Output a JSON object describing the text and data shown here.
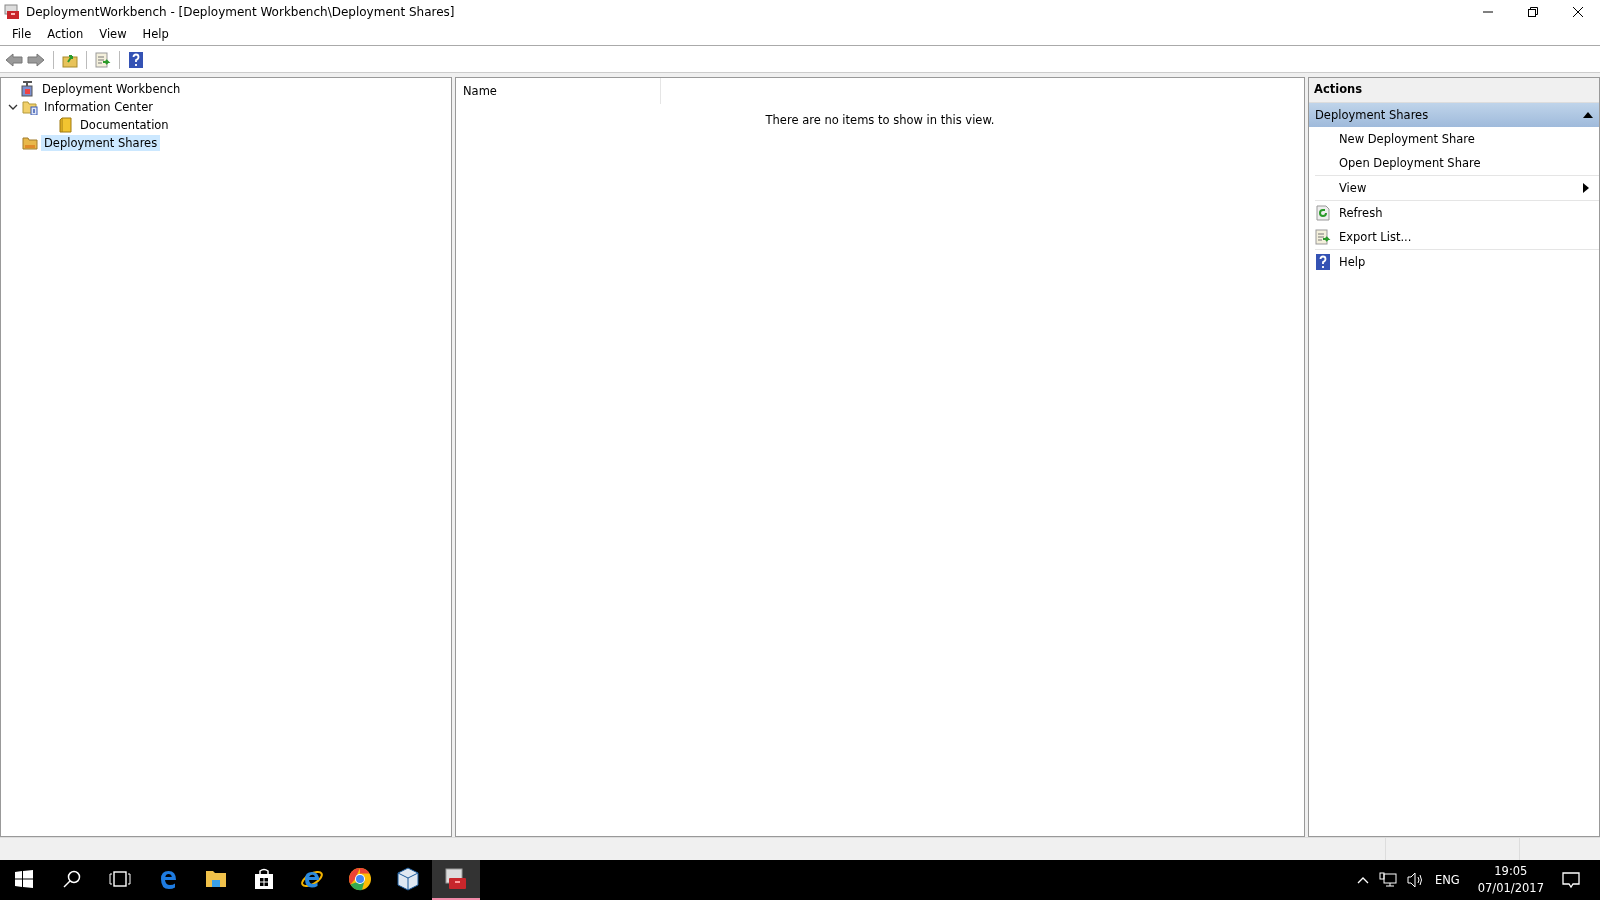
{
  "window": {
    "title": "DeploymentWorkbench - [Deployment Workbench\\Deployment Shares]"
  },
  "menu": [
    "File",
    "Action",
    "View",
    "Help"
  ],
  "tree": [
    {
      "label": "Deployment Workbench",
      "selected": false,
      "children": [
        {
          "label": "Information Center",
          "selected": false,
          "expanded": true,
          "children": [
            {
              "label": "Documentation",
              "selected": false
            }
          ]
        },
        {
          "label": "Deployment Shares",
          "selected": true
        }
      ]
    }
  ],
  "list": {
    "columns": [
      "Name"
    ],
    "empty_message": "There are no items to show in this view."
  },
  "actions": {
    "title": "Actions",
    "section": {
      "label": "Deployment Shares",
      "expanded": true,
      "items": [
        {
          "label": "New Deployment Share",
          "kind": "plain"
        },
        {
          "label": "Open Deployment Share",
          "kind": "plain"
        },
        {
          "label": "View",
          "kind": "submenu"
        },
        {
          "label": "Refresh",
          "kind": "icon"
        },
        {
          "label": "Export List...",
          "kind": "icon"
        },
        {
          "label": "Help",
          "kind": "icon"
        }
      ]
    }
  },
  "taskbar": {
    "apps": [
      {
        "selected": false
      },
      {
        "selected": false
      },
      {
        "selected": false
      },
      {
        "selected": false
      },
      {
        "selected": false
      },
      {
        "selected": false
      },
      {
        "selected": false
      },
      {
        "selected": false
      },
      {
        "selected": false
      },
      {
        "selected": true
      }
    ],
    "language": "ENG",
    "time": "19:05",
    "date": "07/01/2017"
  }
}
